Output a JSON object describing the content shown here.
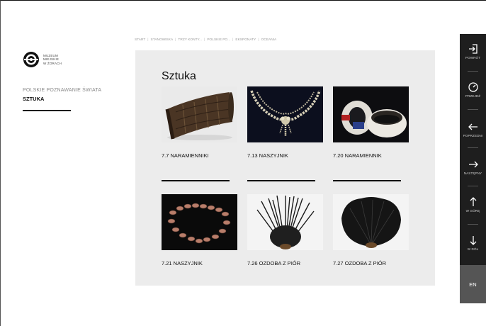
{
  "logo": {
    "line1": "MUZEUM",
    "line2": "MIEJSKIE",
    "line3": "W ŻORACH"
  },
  "breadcrumb": [
    "START",
    "STANOWISKA",
    "TRZY KONTY...",
    "POLSKIE PO...",
    "EKSPONATY",
    "OCEANIA"
  ],
  "section": {
    "label": "POLSKIE POZNAWANIE ŚWIATA",
    "current": "SZTUKA"
  },
  "panel": {
    "title": "Sztuka"
  },
  "items": [
    {
      "label": "7.7 NARAMIENNIKI"
    },
    {
      "label": "7.13 NASZYJNIK"
    },
    {
      "label": "7.20 NARAMIENNIK"
    },
    {
      "label": "7.21 NASZYJNIK"
    },
    {
      "label": "7.26 OZDOBA Z PIÓR"
    },
    {
      "label": "7.27 OZDOBA Z PIÓR"
    }
  ],
  "nav": {
    "back": "POWRÓT",
    "go": "PRZEJDŹ",
    "prev": "POPRZEDNI",
    "next": "NASTĘPNY",
    "up": "W GÓRĘ",
    "down": "W DÓŁ"
  },
  "language": "EN"
}
